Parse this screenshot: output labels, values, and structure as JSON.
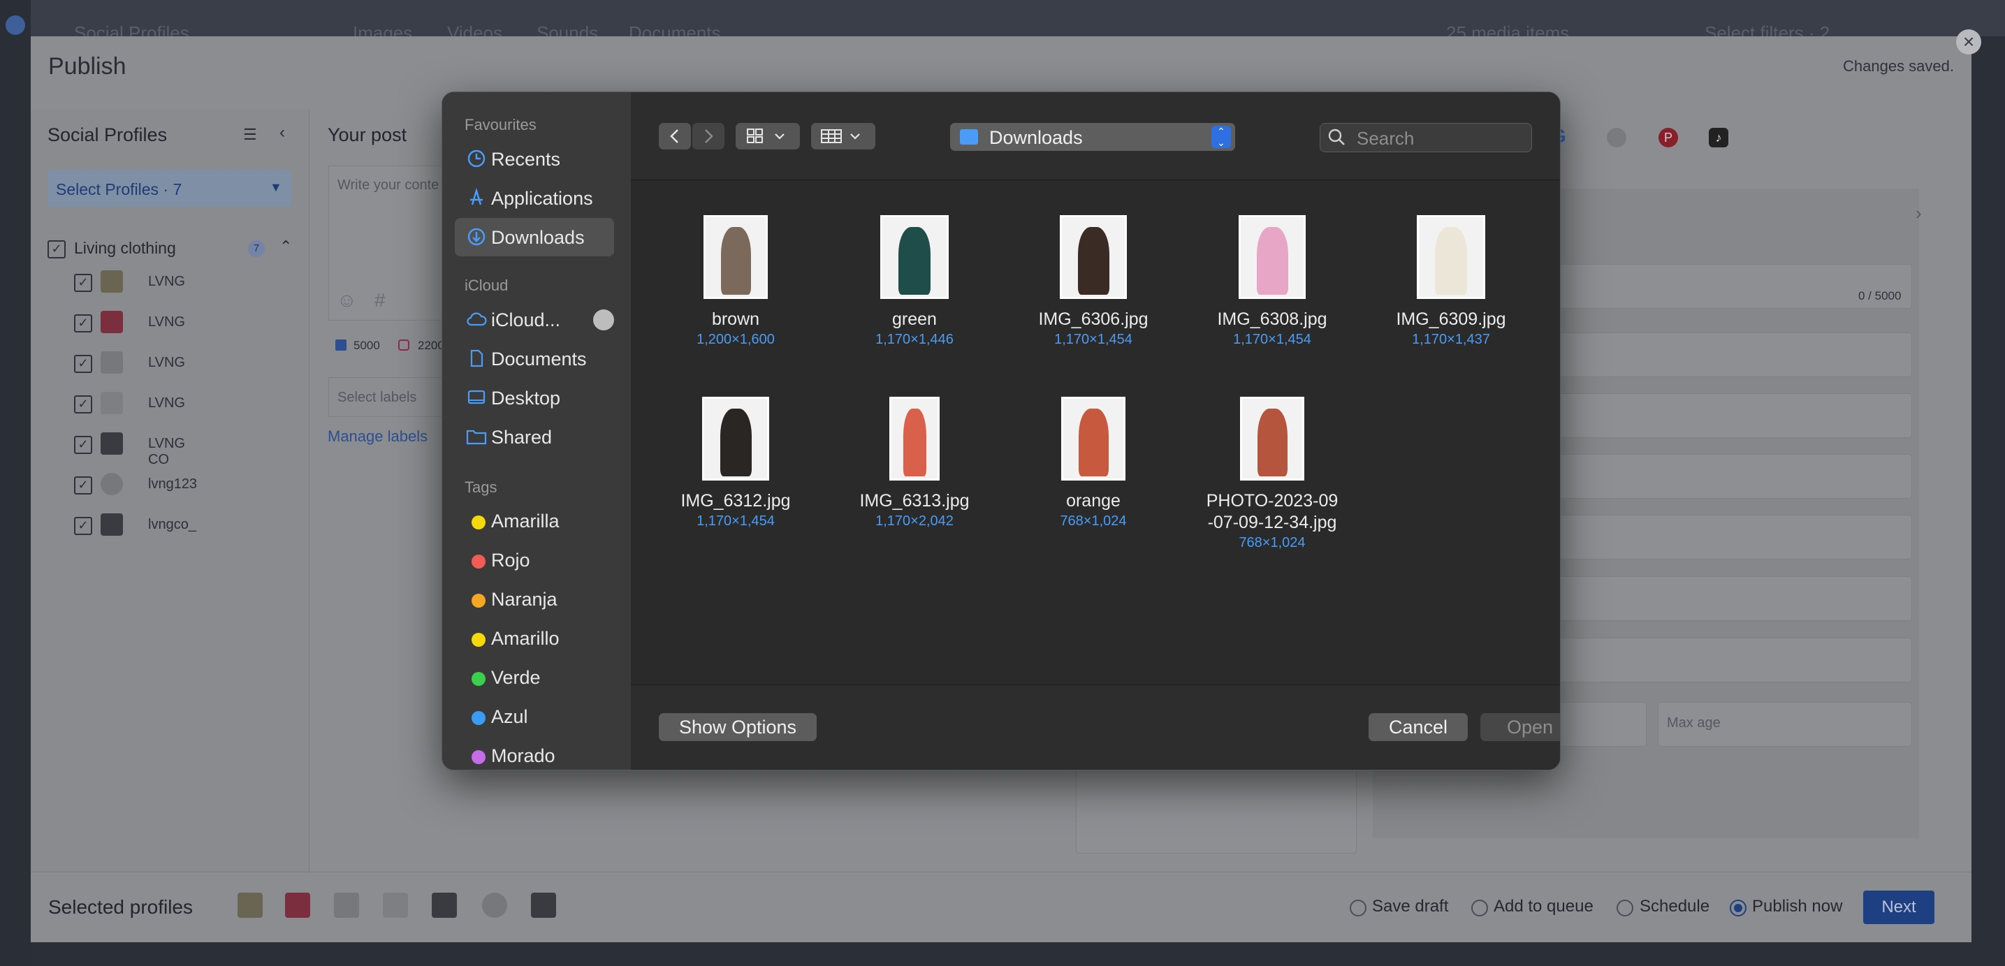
{
  "background": {
    "top_tabs": [
      "Social Profiles",
      "Images",
      "Videos",
      "Sounds",
      "Documents"
    ],
    "media_count": "25 media items",
    "filter_label": "Select filters · 2"
  },
  "publish": {
    "title": "Publish",
    "status": "Changes saved.",
    "social_profiles_title": "Social Profiles",
    "select_profiles": "Select Profiles · 7",
    "group": {
      "name": "Living clothing",
      "count": "7"
    },
    "profiles": [
      {
        "name": "LVNG",
        "network": "facebook"
      },
      {
        "name": "LVNG",
        "network": "youtube"
      },
      {
        "name": "LVNG",
        "network": "twitter"
      },
      {
        "name": "LVNG",
        "network": "google"
      },
      {
        "name": "LVNG CO",
        "network": "tiktok"
      },
      {
        "name": "lvng123",
        "network": "pinterest"
      },
      {
        "name": "lvngco_",
        "network": "instagram"
      }
    ],
    "your_post_title": "Your post",
    "post_placeholder": "Write your conte",
    "char_counts": [
      "5000",
      "2200"
    ],
    "labels_placeholder": "Select labels",
    "manage_labels": "Manage labels",
    "right_counter": "0 / 5000",
    "max_age_placeholder": "Max age",
    "selected_profiles_label": "Selected profiles",
    "options": [
      {
        "label": "Save draft",
        "selected": false
      },
      {
        "label": "Add to queue",
        "selected": false
      },
      {
        "label": "Schedule",
        "selected": false
      },
      {
        "label": "Publish now",
        "selected": true
      }
    ],
    "next_label": "Next"
  },
  "dialog": {
    "sidebar": {
      "favourites_header": "Favourites",
      "favourites": [
        {
          "label": "Recents",
          "icon": "clock-icon",
          "active": false
        },
        {
          "label": "Applications",
          "icon": "applications-icon",
          "active": false
        },
        {
          "label": "Downloads",
          "icon": "downloads-icon",
          "active": true
        }
      ],
      "icloud_header": "iCloud",
      "icloud": [
        {
          "label": "iCloud...",
          "icon": "cloud-icon"
        },
        {
          "label": "Documents",
          "icon": "document-icon"
        },
        {
          "label": "Desktop",
          "icon": "desktop-icon"
        },
        {
          "label": "Shared",
          "icon": "shared-folder-icon"
        }
      ],
      "tags_header": "Tags",
      "tags": [
        {
          "label": "Amarilla",
          "color": "#f5d90a"
        },
        {
          "label": "Rojo",
          "color": "#f25c54"
        },
        {
          "label": "Naranja",
          "color": "#f5a623"
        },
        {
          "label": "Amarillo",
          "color": "#f5d90a"
        },
        {
          "label": "Verde",
          "color": "#3ccf4e"
        },
        {
          "label": "Azul",
          "color": "#3b9cf6"
        },
        {
          "label": "Morado",
          "color": "#c66ce8"
        }
      ]
    },
    "toolbar": {
      "location": "Downloads",
      "search_placeholder": "Search"
    },
    "files": [
      {
        "name": "brown",
        "dims": "1,200×1,600",
        "tone": "#7b6a5c"
      },
      {
        "name": "green",
        "dims": "1,170×1,446",
        "tone": "#1f4d4a"
      },
      {
        "name": "IMG_6306.jpg",
        "dims": "1,170×1,454",
        "tone": "#3a2b24"
      },
      {
        "name": "IMG_6308.jpg",
        "dims": "1,170×1,454",
        "tone": "#e8a6c6"
      },
      {
        "name": "IMG_6309.jpg",
        "dims": "1,170×1,437",
        "tone": "#ece6d8"
      },
      {
        "name": "IMG_6312.jpg",
        "dims": "1,170×1,454",
        "tone": "#2a2624"
      },
      {
        "name": "IMG_6313.jpg",
        "dims": "1,170×2,042",
        "tone": "#d9604a"
      },
      {
        "name": "orange",
        "dims": "768×1,024",
        "tone": "#c75a3e"
      },
      {
        "name": "PHOTO-2023-09\n-07-09-12-34.jpg",
        "dims": "768×1,024",
        "tone": "#b5553e"
      }
    ],
    "footer": {
      "show_options": "Show Options",
      "cancel": "Cancel",
      "open": "Open"
    }
  }
}
